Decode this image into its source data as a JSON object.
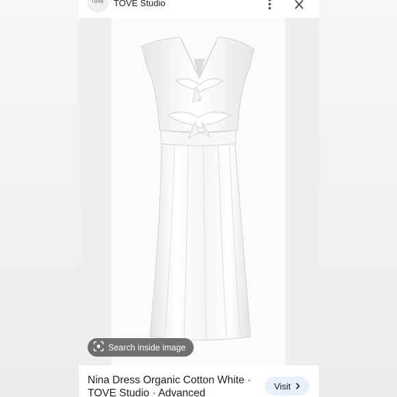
{
  "header": {
    "logo_text": "TOVE",
    "site_name": "TOVE Studio",
    "menu_icon": "more-vert-icon",
    "close_icon": "close-icon"
  },
  "image": {
    "subject": "white-dress-image"
  },
  "lens": {
    "label": "Search inside image",
    "icon": "lens-icon"
  },
  "result": {
    "title_line1": "Nina Dress Organic Cotton White ·",
    "title_line2": "TOVE Studio · Advanced"
  },
  "visit": {
    "label": "Visit",
    "icon": "chevron-right-icon",
    "accent": "#e8f0fe"
  }
}
